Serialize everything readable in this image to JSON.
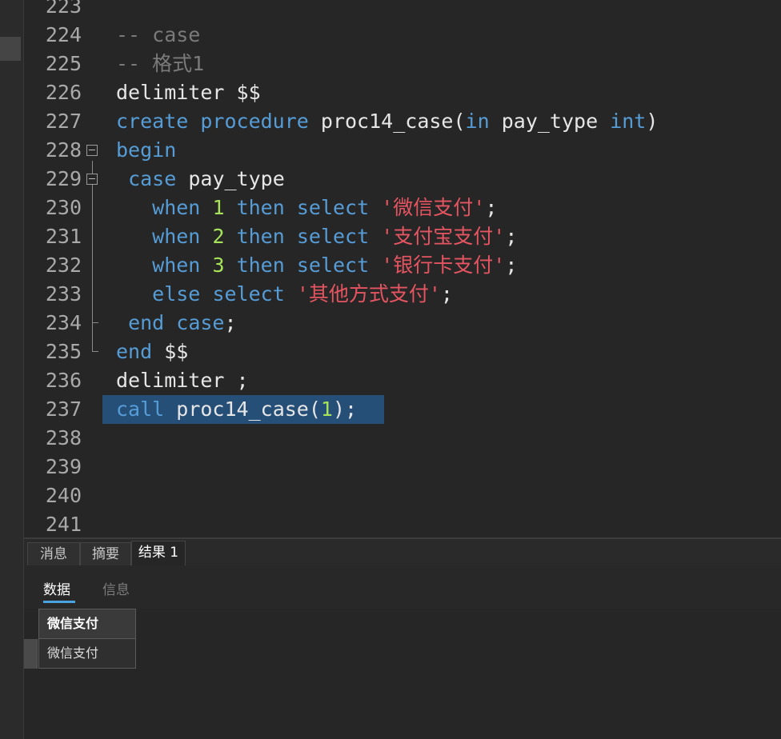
{
  "editor": {
    "lines": [
      {
        "num": "223",
        "code": ""
      },
      {
        "num": "224",
        "code": "-- case"
      },
      {
        "num": "225",
        "code": "-- 格式1"
      },
      {
        "num": "226",
        "code": "delimiter $$"
      },
      {
        "num": "227",
        "code": "create procedure proc14_case(in pay_type int)"
      },
      {
        "num": "228",
        "code": "begin"
      },
      {
        "num": "229",
        "code": " case pay_type"
      },
      {
        "num": "230",
        "code": "   when 1 then select '微信支付';"
      },
      {
        "num": "231",
        "code": "   when 2 then select '支付宝支付';"
      },
      {
        "num": "232",
        "code": "   when 3 then select '银行卡支付';"
      },
      {
        "num": "233",
        "code": "   else select '其他方式支付';"
      },
      {
        "num": "234",
        "code": " end case;"
      },
      {
        "num": "235",
        "code": "end $$"
      },
      {
        "num": "236",
        "code": "delimiter ;"
      },
      {
        "num": "237",
        "code": "call proc14_case(1);"
      },
      {
        "num": "238",
        "code": ""
      },
      {
        "num": "239",
        "code": ""
      },
      {
        "num": "240",
        "code": ""
      },
      {
        "num": "241",
        "code": ""
      }
    ],
    "selected_line": "237"
  },
  "bottom_tabs": [
    {
      "label": "消息",
      "active": false
    },
    {
      "label": "摘要",
      "active": false
    },
    {
      "label": "结果 1",
      "active": true
    }
  ],
  "sub_tabs": [
    {
      "label": "数据",
      "active": true
    },
    {
      "label": "信息",
      "active": false
    }
  ],
  "result_grid": {
    "columns": [
      "微信支付"
    ],
    "rows": [
      [
        "微信支付"
      ]
    ]
  },
  "colors": {
    "keyword": "#569cd6",
    "string": "#e55561",
    "number": "#a6e35a",
    "comment": "#7a7a7a",
    "selection": "#264f78",
    "active_subtab_underline": "#4aa3df"
  }
}
